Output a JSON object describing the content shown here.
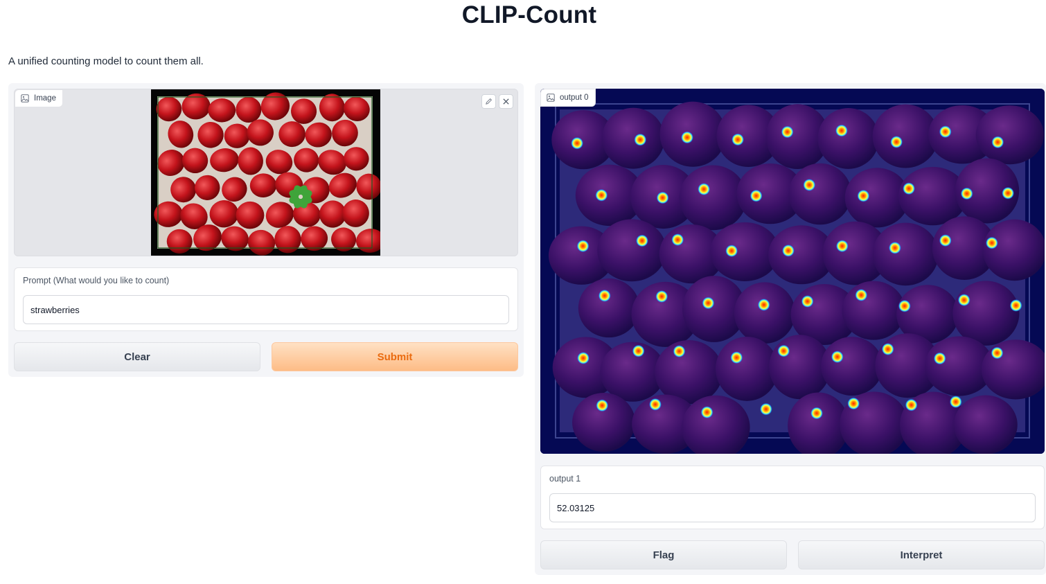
{
  "header": {
    "title": "CLIP-Count",
    "description": "A unified counting model to count them all."
  },
  "input_panel": {
    "image_label": "Image",
    "prompt_label": "Prompt (What would you like to count)",
    "prompt_value": "strawberries",
    "clear_label": "Clear",
    "submit_label": "Submit"
  },
  "output_panel": {
    "image_label": "output 0",
    "count_label": "output 1",
    "count_value": "52.03125",
    "flag_label": "Flag",
    "interpret_label": "Interpret"
  },
  "colors": {
    "accent": "#ea6b10",
    "heatmap_base": "#050954"
  },
  "icons": [
    "image-icon",
    "edit-icon",
    "close-icon"
  ]
}
